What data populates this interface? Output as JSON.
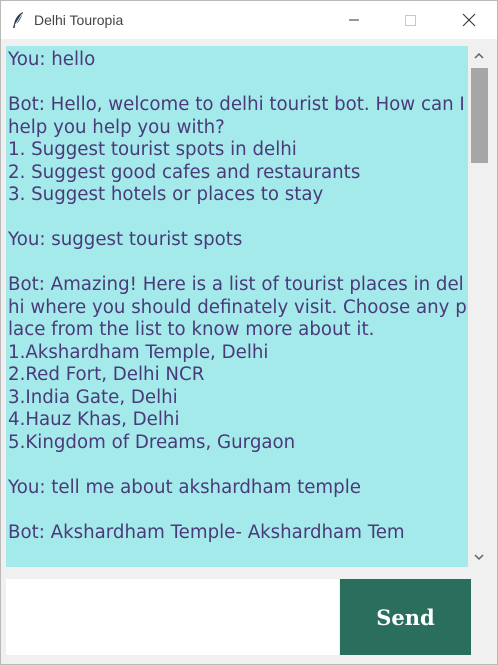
{
  "window": {
    "title": "Delhi Touropia",
    "icon": "feather-icon",
    "controls": [
      "minimize-icon",
      "maximize-icon",
      "close-icon"
    ]
  },
  "chat": {
    "transcript": "You: hello\n\nBot: Hello, welcome to delhi tourist bot. How can I help you help you with?\n1. Suggest tourist spots in delhi\n2. Suggest good cafes and restaurants\n3. Suggest hotels or places to stay\n\nYou: suggest tourist spots\n\nBot: Amazing! Here is a list of tourist places in delhi where you should definately visit. Choose any place from the list to know more about it.\n1.Akshardham Temple, Delhi\n2.Red Fort, Delhi NCR\n3.India Gate, Delhi\n4.Hauz Khas, Delhi\n5.Kingdom of Dreams, Gurgaon\n\nYou: tell me about akshardham temple\n\nBot: Akshardham Temple- Akshardham Tem"
  },
  "composer": {
    "input_value": "",
    "send_label": "Send"
  },
  "colors": {
    "chat_background": "#a4eaea",
    "chat_text": "#4a3a7a",
    "send_button": "#2a6f5e"
  }
}
